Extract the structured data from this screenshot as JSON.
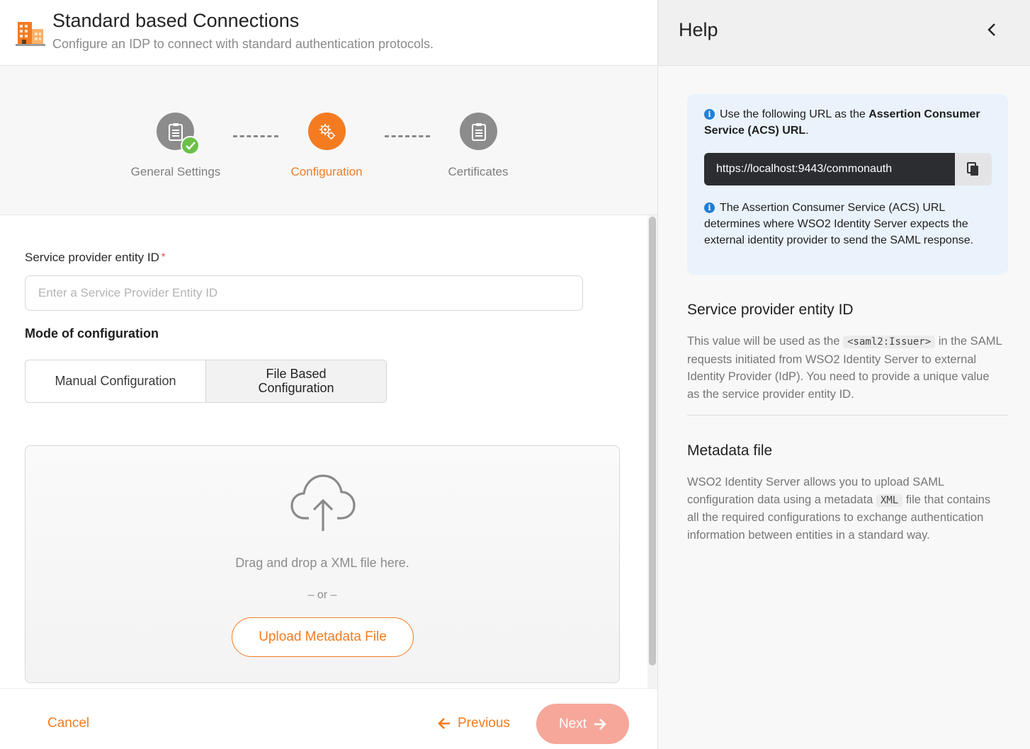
{
  "header": {
    "title": "Standard based Connections",
    "subtitle": "Configure an IDP to connect with standard authentication protocols."
  },
  "stepper": {
    "steps": [
      {
        "label": "General Settings",
        "state": "completed"
      },
      {
        "label": "Configuration",
        "state": "active"
      },
      {
        "label": "Certificates",
        "state": "pending"
      }
    ]
  },
  "form": {
    "entity_id_label": "Service provider entity ID",
    "entity_id_required": "*",
    "entity_id_placeholder": "Enter a Service Provider Entity ID",
    "entity_id_value": "",
    "mode_label": "Mode of configuration",
    "mode_options": [
      "Manual Configuration",
      "File Based Configuration"
    ],
    "mode_selected": "File Based Configuration"
  },
  "dropzone": {
    "drag_text": "Drag and drop a XML file here.",
    "or_text": "– or –",
    "upload_label": "Upload Metadata File"
  },
  "footer": {
    "cancel_label": "Cancel",
    "previous_label": "Previous",
    "next_label": "Next"
  },
  "help": {
    "title": "Help",
    "acs_intro": "Use the following URL as the",
    "acs_bold": "Assertion Consumer Service (ACS) URL",
    "acs_intro_end": ".",
    "acs_url": "https://localhost:9443/commonauth",
    "acs_note": "The Assertion Consumer Service (ACS) URL determines where WSO2 Identity Server expects the external identity provider to send the SAML response.",
    "entity_heading": "Service provider entity ID",
    "entity_p1": "This value will be used as the",
    "entity_code": "<saml2:Issuer>",
    "entity_p2": "in the SAML requests initiated from WSO2 Identity Server to external Identity Provider (IdP). You need to provide a unique value as the service provider entity ID.",
    "metadata_heading": "Metadata file",
    "metadata_p1": "WSO2 Identity Server allows you to upload SAML configuration data using a metadata",
    "metadata_code": "XML",
    "metadata_p2": "file that contains all the required configurations to exchange authentication information between entities in a standard way."
  },
  "colors": {
    "accent": "#f47b20",
    "step_completed": "#8c8c8c",
    "step_check": "#6cc04a",
    "next_disabled": "#f6a79a",
    "info_bg": "#eaf3fb"
  },
  "icons": {
    "logo": "building-icon",
    "step_general": "clipboard-icon",
    "step_configuration": "gears-icon",
    "step_certificates": "clipboard-icon",
    "upload": "cloud-upload-icon",
    "previous": "arrow-left-icon",
    "next": "arrow-right-icon",
    "back": "chevron-left-icon",
    "info": "info-icon",
    "copy": "copy-icon"
  }
}
